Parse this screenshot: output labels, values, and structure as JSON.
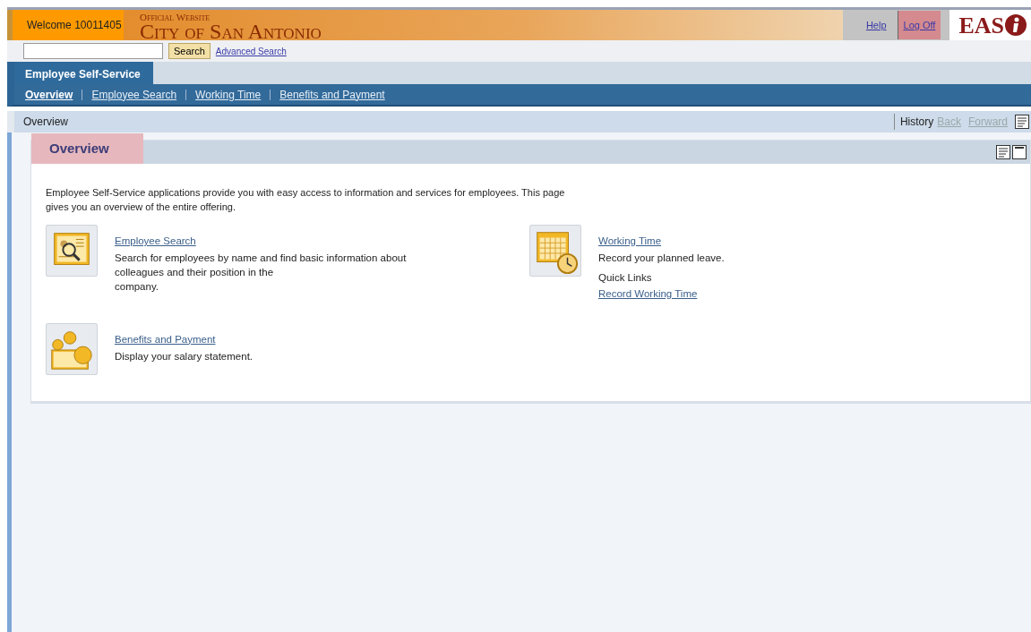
{
  "header": {
    "welcome": "Welcome 10011405",
    "banner_small": "Official Website",
    "banner_title": "City of San Antonio",
    "links": [
      {
        "label": "Help",
        "highlighted": false
      },
      {
        "label": "Log Off",
        "highlighted": true
      }
    ],
    "logo": "EAS"
  },
  "search": {
    "button": "Search",
    "advanced": "Advanced Search"
  },
  "top_tabs": [
    {
      "label": "Employee Self-Service",
      "selected": true
    }
  ],
  "sub_nav": [
    {
      "label": "Overview",
      "selected": true
    },
    {
      "label": "Employee Search",
      "selected": false
    },
    {
      "label": "Working Time",
      "selected": false
    },
    {
      "label": "Benefits and Payment",
      "selected": false
    }
  ],
  "breadcrumb": {
    "title": "Overview",
    "history": "History",
    "nav": [
      {
        "label": "Back",
        "disabled": true
      },
      {
        "label": "Forward",
        "disabled": true
      }
    ]
  },
  "panel": {
    "title": "Overview",
    "title_highlighted": true,
    "intro": "Employee Self-Service applications provide you with easy access to information and services for employees.  This page gives you an overview of the entire offering.",
    "services": [
      {
        "kind": "search",
        "title": "Employee Search",
        "description_lines": [
          "Search for employees by name and find basic information about",
          "colleagues and their position in the",
          "company."
        ]
      },
      {
        "kind": "calendar",
        "title": "Working Time",
        "description_lines": [
          "Record your planned leave."
        ],
        "quick_links_label": "Quick Links",
        "quick_links": [
          "Record Working Time"
        ]
      },
      {
        "kind": "money",
        "title": "Benefits and Payment",
        "description_lines": [
          "Display your salary statement."
        ]
      }
    ]
  }
}
